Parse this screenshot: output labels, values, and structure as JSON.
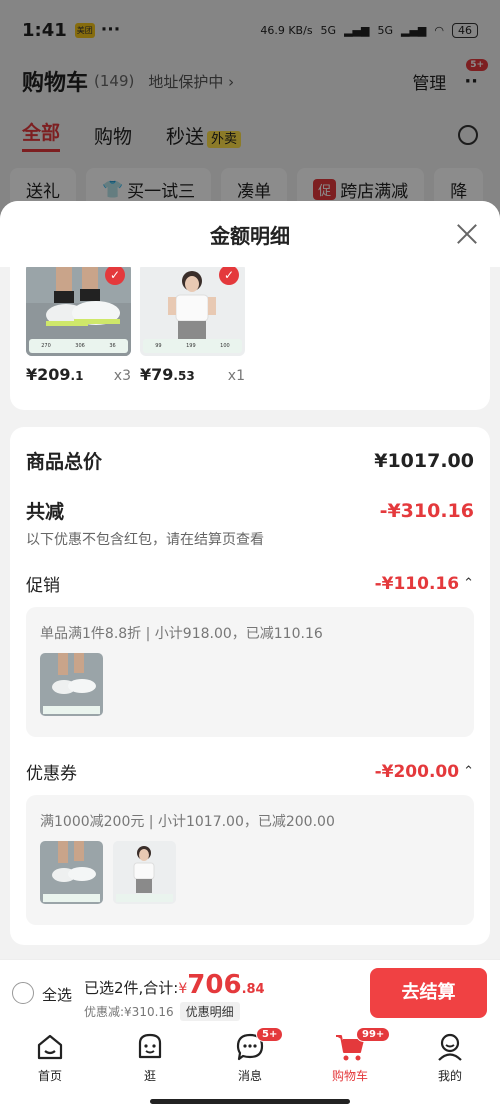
{
  "status_bar": {
    "time": "1:41",
    "app_badge": "美团",
    "dots": "···",
    "net_speed": "46.9 KB/s",
    "signal_1": "5G",
    "signal_2": "5G",
    "battery": "46"
  },
  "cart_header": {
    "title": "购物车",
    "count": "(149)",
    "address_protect": "地址保护中 ›",
    "manage": "管理",
    "more_badge": "5+"
  },
  "cart_tabs": [
    {
      "label": "全部"
    },
    {
      "label": "购物"
    },
    {
      "label": "秒送"
    }
  ],
  "takeout_badge": "外卖",
  "chips": [
    {
      "label": "送礼"
    },
    {
      "label": "买一试三"
    },
    {
      "label": "凑单"
    },
    {
      "label": "跨店满减",
      "prefix": "促"
    },
    {
      "label": "降"
    }
  ],
  "sheet": {
    "title": "金额明细",
    "products": [
      {
        "price_main": "¥209",
        "price_decimal": ".1",
        "qty": "x3",
        "strip": [
          "270",
          "306",
          "36"
        ]
      },
      {
        "price_main": "¥79",
        "price_decimal": ".53",
        "qty": "x1",
        "strip": [
          "99",
          "199",
          "100"
        ]
      }
    ],
    "total_label": "商品总价",
    "total_value": "¥1017.00",
    "reduce_label": "共减",
    "reduce_value": "-¥310.16",
    "reduce_note": "以下优惠不包含红包，请在结算页查看",
    "promo_label": "促销",
    "promo_value": "-¥110.16",
    "promo_detail": "单品满1件8.8折 | 小计918.00，已减110.16",
    "coupon_label": "优惠券",
    "coupon_value": "-¥200.00",
    "coupon_detail": "满1000减200元 | 小计1017.00，已减200.00"
  },
  "checkout": {
    "select_all": "全选",
    "selected_text": "已选2件,合计:",
    "yen": "¥",
    "total_int": "706",
    "total_dec": ".84",
    "discount_text": "优惠减:¥310.16",
    "discount_detail_btn": "优惠明细",
    "checkout_btn": "去结算"
  },
  "bottom_nav": [
    {
      "label": "首页"
    },
    {
      "label": "逛"
    },
    {
      "label": "消息",
      "badge": "5+"
    },
    {
      "label": "购物车",
      "badge": "99+"
    },
    {
      "label": "我的"
    }
  ],
  "colors": {
    "accent": "#e4393c",
    "checkout_button": "#f04143"
  },
  "icons": {
    "close": "close-icon",
    "home": "home-icon",
    "browse": "face-icon",
    "message": "chat-bubble-icon",
    "cart": "cart-icon",
    "profile": "person-icon",
    "chevron_up": "chevron-up-icon"
  }
}
